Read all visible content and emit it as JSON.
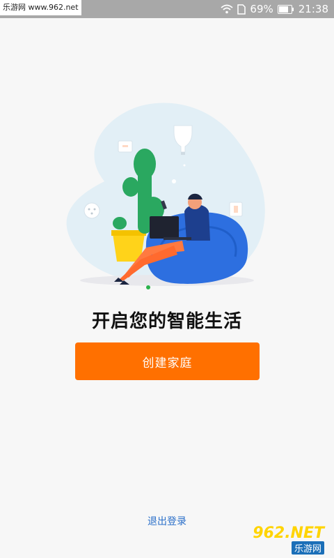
{
  "status_bar": {
    "watermark_label": "乐游网 www.962.net",
    "battery_percent": "69%",
    "time": "21:38",
    "icons": [
      "wifi-icon",
      "sim-icon",
      "battery-icon"
    ]
  },
  "main": {
    "headline": "开启您的智能生活",
    "create_button_label": "创建家庭",
    "logout_label": "退出登录",
    "pager": {
      "count": 1,
      "active": 0
    }
  },
  "watermark": {
    "logo_text": "962.NET",
    "logo_sub": "乐游网"
  },
  "colors": {
    "accent": "#ff7000",
    "link": "#2a6fc9",
    "dot": "#2bb24c"
  }
}
